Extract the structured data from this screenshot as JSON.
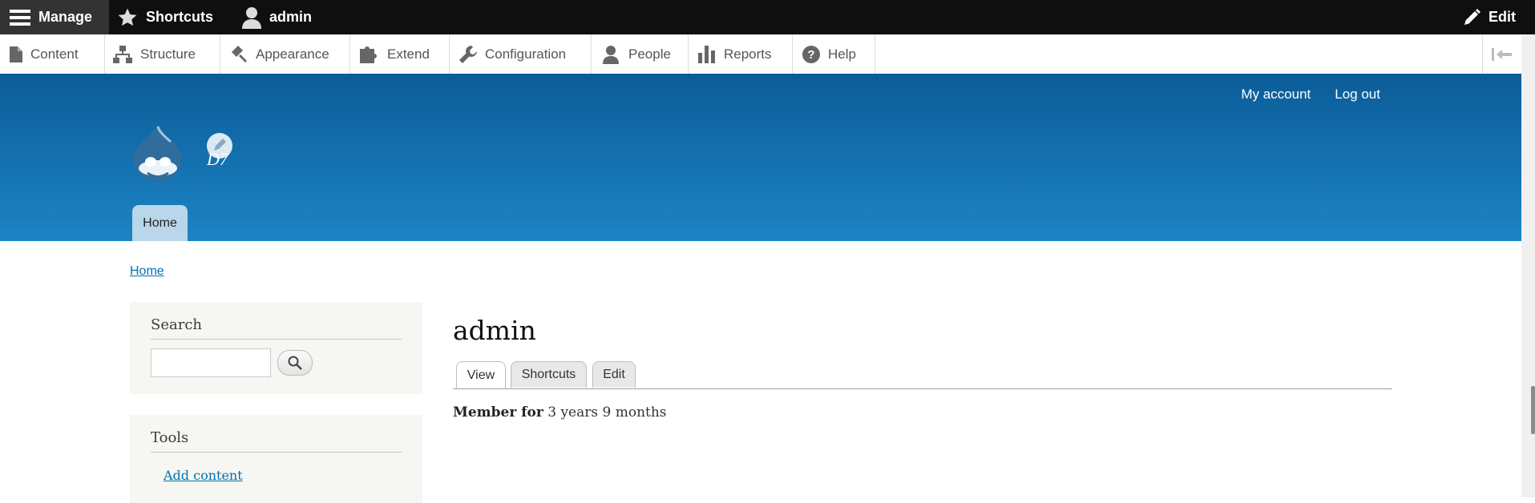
{
  "toolbar": {
    "manage_label": "Manage",
    "shortcuts_label": "Shortcuts",
    "user_label": "admin",
    "edit_label": "Edit"
  },
  "tray": {
    "items": [
      {
        "label": "Content",
        "icon": "page-icon"
      },
      {
        "label": "Structure",
        "icon": "sitemap-icon"
      },
      {
        "label": "Appearance",
        "icon": "paintbrush-icon"
      },
      {
        "label": "Extend",
        "icon": "puzzle-icon"
      },
      {
        "label": "Configuration",
        "icon": "wrench-icon"
      },
      {
        "label": "People",
        "icon": "person-icon"
      },
      {
        "label": "Reports",
        "icon": "bar-chart-icon"
      },
      {
        "label": "Help",
        "icon": "help-icon"
      }
    ]
  },
  "header": {
    "secondary_menu": [
      "My account",
      "Log out"
    ],
    "site_name": "D7",
    "main_menu": [
      "Home"
    ]
  },
  "breadcrumb": "Home",
  "sidebar": {
    "search": {
      "title": "Search",
      "input_value": ""
    },
    "tools": {
      "title": "Tools",
      "links": [
        "Add content"
      ]
    }
  },
  "main": {
    "title": "admin",
    "tabs": [
      "View",
      "Shortcuts",
      "Edit"
    ],
    "active_tab": "View",
    "member_for_label": "Member for",
    "member_for_value": "3 years 9 months"
  },
  "colors": {
    "toolbar_bg": "#0f0f0f",
    "header_top": "#0b5c98",
    "header_bottom": "#1d84c4",
    "link": "#0071b3"
  }
}
